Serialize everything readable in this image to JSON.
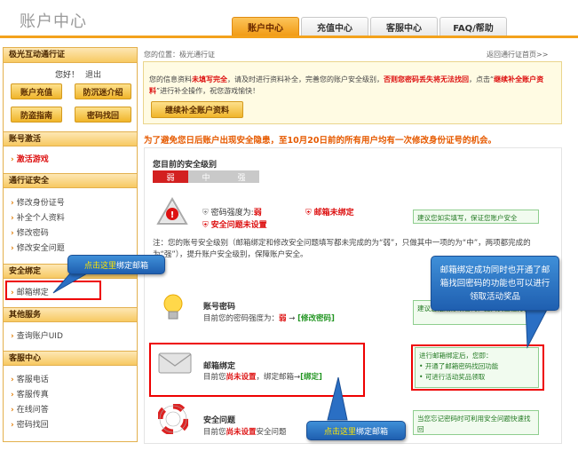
{
  "header": {
    "title": "账户中心",
    "tabs": [
      "账户中心",
      "充值中心",
      "客服中心",
      "FAQ/帮助"
    ]
  },
  "sidebar": {
    "pass_title": "极光互动通行证",
    "greeting": "您好！",
    "logout": "退出",
    "buttons": [
      "账户充值",
      "防沉迷介绍",
      "防盗指南",
      "密码找回"
    ],
    "activate": {
      "title": "账号激活",
      "items": [
        "激活游戏"
      ]
    },
    "security": {
      "title": "通行证安全",
      "items": [
        "修改身份证号",
        "补全个人资料",
        "修改密码",
        "修改安全问题"
      ]
    },
    "binding": {
      "title": "安全绑定",
      "items": [
        "邮箱绑定"
      ]
    },
    "other": {
      "title": "其他服务",
      "items": [
        "查询账户UID"
      ]
    },
    "service": {
      "title": "客服中心",
      "items": [
        "客服电话",
        "客服传真",
        "在线问答",
        "密码找回"
      ]
    }
  },
  "main": {
    "breadcrumb": "您的位置：极光通行证",
    "back_link": "返回通行证首页>>",
    "notice_a": "您的信息资料",
    "notice_b": "未填写完全",
    "notice_c": "，请及时进行资料补全，完善您的账户安全级别，",
    "notice_d": "否则您密码丢失将无法找回",
    "notice_e": "，点击“",
    "notice_f": "继续补全账户资料",
    "notice_g": "”进行补全操作，祝您游戏愉快！",
    "notice_button": "继续补全账户资料",
    "warning": "为了避免您日后账户出现安全隐患，至10月20日前的所有用户均有一次修改身份证号的机会。",
    "level_title": "您目前的安全级别",
    "levels": [
      "弱",
      "中",
      "强"
    ],
    "pwd_strength_label": "密码强度为:",
    "pwd_strength_value": "弱",
    "email_unbound": "邮箱未绑定",
    "question_unset": "安全问题未设置",
    "green_tip_1": "建议您如实填写，保证您账户安全",
    "explain": "注：您的账号安全级别（邮箱绑定和修改安全问题填写都未完成的为“弱”，只做其中一项的为“中”，两项都完成的为“强”），提升账户安全级别，保障账户安全。",
    "account_pwd_title": "账号密码",
    "account_pwd_desc": "目前您的密码强度为：",
    "account_pwd_value": "弱",
    "account_pwd_link": "[修改密码]",
    "green_tip_2": "建议您定期修改密码，提高安全性方面",
    "email_title": "邮箱绑定",
    "email_desc_a": "目前您",
    "email_desc_b": "尚未设置",
    "email_desc_c": "，绑定邮箱→",
    "email_link": "[绑定]",
    "green_tip_3_title": "进行邮箱绑定后，您即：",
    "green_tip_3_items": [
      "开通了邮箱密码找回功能",
      "可进行活动奖品领取"
    ],
    "question_title": "安全问题",
    "question_desc_a": "目前您",
    "question_desc_b": "尚未设置",
    "question_desc_c": "安全问题",
    "green_tip_4": "当您忘记密码时可利用安全问题快速找回"
  },
  "callouts": {
    "left_a": "点击这里",
    "left_b": "绑定邮箱",
    "right": "邮箱绑定成功同时也开通了邮箱找回密码的功能也可以进行领取活动奖品",
    "bottom_a": "点击这里",
    "bottom_b": "绑定邮箱"
  },
  "colors": {
    "accent": "#f3a21c",
    "danger": "#dd1111",
    "callout": "#2a6fc4"
  }
}
